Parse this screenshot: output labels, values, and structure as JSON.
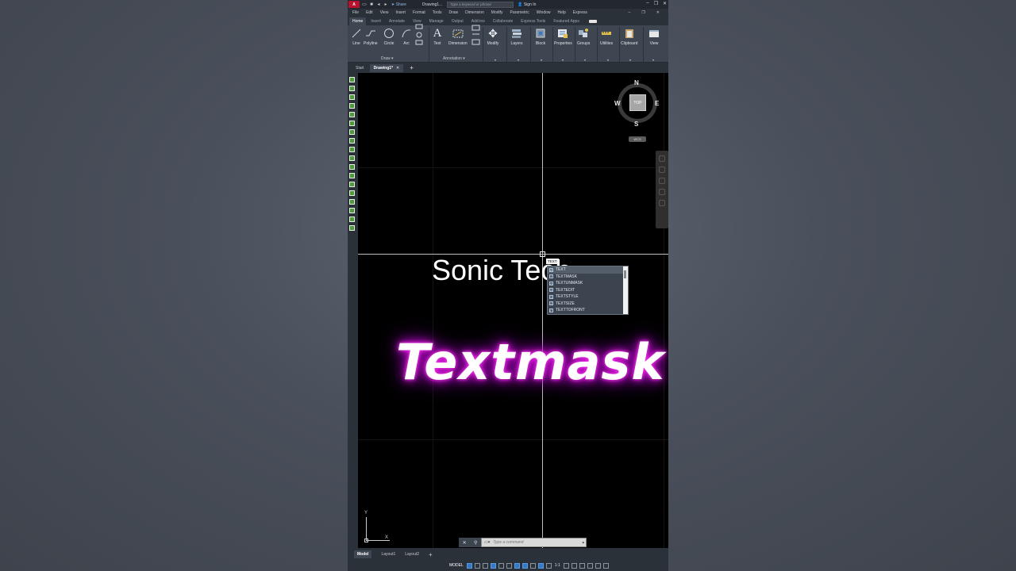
{
  "titlebar": {
    "logo": "A CAD",
    "share": "Share",
    "doc_title": "Drawing1...",
    "search_placeholder": "Type a keyword or phrase",
    "signin": "Sign In"
  },
  "menubar": [
    "File",
    "Edit",
    "View",
    "Insert",
    "Format",
    "Tools",
    "Draw",
    "Dimension",
    "Modify",
    "Parametric",
    "Window",
    "Help",
    "Express"
  ],
  "ribbon_tabs": [
    "Home",
    "Insert",
    "Annotate",
    "View",
    "Manage",
    "Output",
    "Add-ins",
    "Collaborate",
    "Express Tools",
    "Featured Apps"
  ],
  "ribbon": {
    "draw_tools": [
      "Line",
      "Polyline",
      "Circle",
      "Arc"
    ],
    "annotation_tools": [
      "Text",
      "Dimension"
    ],
    "big_tools": [
      "Modify",
      "Layers",
      "Block",
      "Properties",
      "Groups",
      "Utilities",
      "Clipboard",
      "View"
    ],
    "panel_draw": "Draw",
    "panel_annotation": "Annotation"
  },
  "doctabs": {
    "start": "Start",
    "drawing": "Drawing1*"
  },
  "canvas": {
    "sonic_text": "Sonic Tech",
    "textmask_text": "Textmask",
    "typed": "TEXT"
  },
  "autocomplete": [
    {
      "label": "TEXT",
      "icon": "A"
    },
    {
      "label": "TEXTMASK",
      "icon": "T"
    },
    {
      "label": "TEXTUNMASK",
      "icon": "A"
    },
    {
      "label": "TEXTEDIT",
      "icon": "A"
    },
    {
      "label": "TEXTSTYLE",
      "icon": "S"
    },
    {
      "label": "TEXTSIZE",
      "icon": "Z"
    },
    {
      "label": "TEXTTOFRONT",
      "icon": "F"
    }
  ],
  "viewcube": {
    "top": "TOP",
    "n": "N",
    "s": "S",
    "e": "E",
    "w": "W",
    "wcs": "WCS"
  },
  "ucs": {
    "x": "X",
    "y": "Y"
  },
  "cmdline": {
    "placeholder": "Type a command"
  },
  "layouttabs": [
    "Model",
    "Layout1",
    "Layout2"
  ],
  "statusbar": {
    "model": "MODEL",
    "scale": "1:1"
  }
}
